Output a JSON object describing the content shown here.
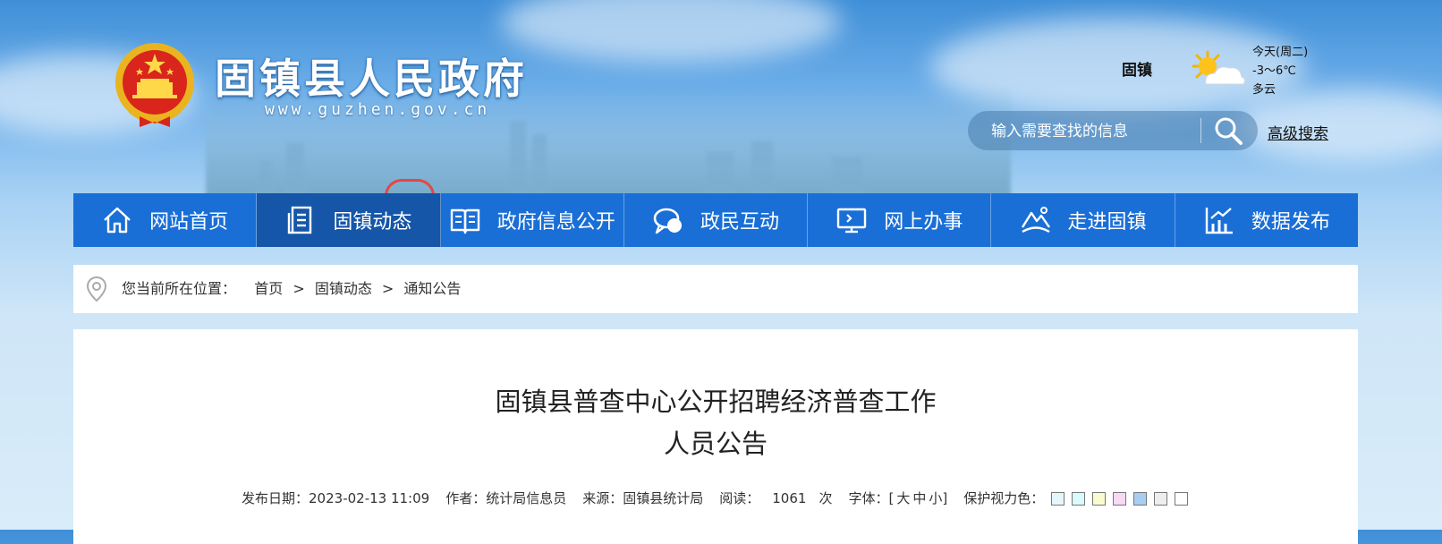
{
  "header": {
    "site_name": "固镇县人民政府",
    "site_url": "www.guzhen.gov.cn"
  },
  "weather": {
    "city": "固镇",
    "day": "今天(周二)",
    "temp": "-3～6℃",
    "condition": "多云",
    "icon": "partly-cloudy-icon"
  },
  "search": {
    "placeholder": "输入需要查找的信息",
    "advanced_label": "高级搜索"
  },
  "nav": {
    "items": [
      {
        "label": "网站首页",
        "icon": "home-icon"
      },
      {
        "label": "固镇动态",
        "icon": "news-list-icon"
      },
      {
        "label": "政府信息公开",
        "icon": "open-book-icon"
      },
      {
        "label": "政民互动",
        "icon": "chat-bubble-icon"
      },
      {
        "label": "网上办事",
        "icon": "monitor-icon"
      },
      {
        "label": "走进固镇",
        "icon": "mountain-icon"
      },
      {
        "label": "数据发布",
        "icon": "bar-chart-icon"
      }
    ],
    "active_index": 1
  },
  "breadcrumb": {
    "prefix": "您当前所在位置：",
    "items": [
      "首页",
      "固镇动态",
      "通知公告"
    ],
    "separator": ">"
  },
  "article": {
    "title_line1": "固镇县普查中心公开招聘经济普查工作",
    "title_line2": "人员公告",
    "meta": {
      "date_label": "发布日期：",
      "date": "2023-02-13 11:09",
      "author_label": "作者：",
      "author": "统计局信息员",
      "source_label": "来源：",
      "source": "固镇县统计局",
      "views_label": "阅读：",
      "views": "1061",
      "views_unit": "次",
      "font_label": "字体：",
      "font_open": "[",
      "font_large": "大",
      "font_medium": "中",
      "font_small": "小",
      "font_close": "]",
      "eye_label": "保护视力色：",
      "eye_colors": [
        "#e6f7fb",
        "#d9fbfb",
        "#fbfbd0",
        "#f8d9f4",
        "#a7cdf3",
        "#eeeeee",
        "#ffffff"
      ]
    }
  },
  "colors": {
    "nav_bg": "#1a6fd6",
    "nav_active": "#1556a8"
  }
}
